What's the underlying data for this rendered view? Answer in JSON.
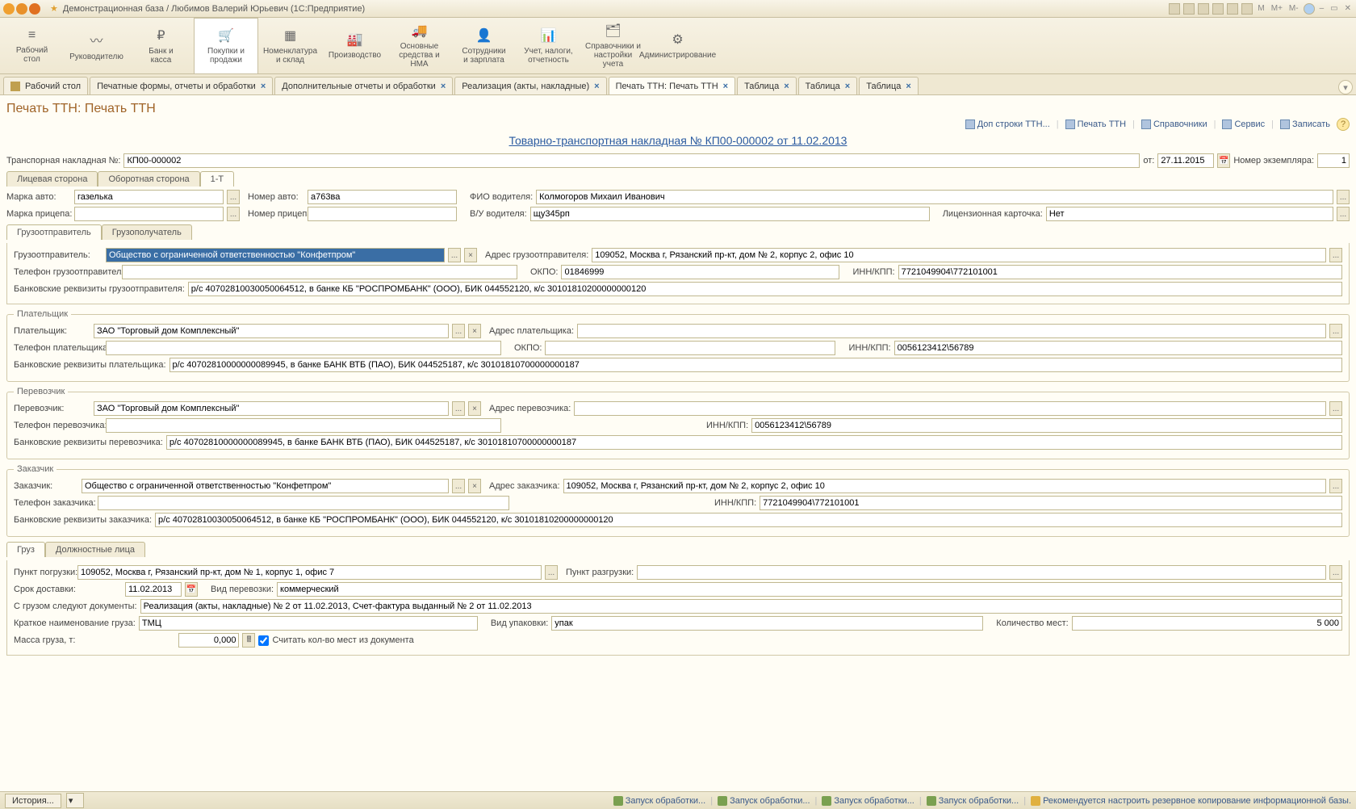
{
  "window": {
    "title": "Демонстрационная база / Любимов Валерий Юрьевич  (1С:Предприятие)",
    "right_icons": [
      "M",
      "M+",
      "M-"
    ]
  },
  "nav": [
    {
      "icon": "≡",
      "label": "Рабочий\nстол"
    },
    {
      "icon": "〰",
      "label": "Руководителю"
    },
    {
      "icon": "₽",
      "label": "Банк и\nкасса"
    },
    {
      "icon": "🛒",
      "label": "Покупки и\nпродажи"
    },
    {
      "icon": "▦",
      "label": "Номенклатура\nи склад"
    },
    {
      "icon": "🏭",
      "label": "Производство"
    },
    {
      "icon": "🚚",
      "label": "Основные\nсредства и НМА"
    },
    {
      "icon": "👤",
      "label": "Сотрудники\nи зарплата"
    },
    {
      "icon": "📊",
      "label": "Учет, налоги,\nотчетность"
    },
    {
      "icon": "🗂",
      "label": "Справочники и\nнастройки учета"
    },
    {
      "icon": "⚙",
      "label": "Администрирование"
    }
  ],
  "nav_active_index": 3,
  "tabs": [
    {
      "label": "Рабочий стол",
      "closable": false,
      "icon": true
    },
    {
      "label": "Печатные формы, отчеты и обработки",
      "closable": true
    },
    {
      "label": "Дополнительные отчеты и обработки",
      "closable": true
    },
    {
      "label": "Реализация (акты, накладные)",
      "closable": true
    },
    {
      "label": "Печать ТТН: Печать ТТН",
      "closable": true,
      "active": true
    },
    {
      "label": "Таблица",
      "closable": true
    },
    {
      "label": "Таблица",
      "closable": true
    },
    {
      "label": "Таблица",
      "closable": true
    }
  ],
  "page": {
    "title": "Печать ТТН: Печать ТТН",
    "toolbar": [
      {
        "label": "Доп строки ТТН..."
      },
      {
        "label": "Печать ТТН"
      },
      {
        "label": "Справочники"
      },
      {
        "label": "Сервис"
      },
      {
        "label": "Записать"
      }
    ],
    "doc_link": "Товарно-транспортная накладная № КП00-000002 от 11.02.2013"
  },
  "header": {
    "invoice_label": "Транспорная накладная №:",
    "invoice_no": "КП00-000002",
    "date_label": "от:",
    "date": "27.11.2015",
    "copies_label": "Номер экземпляра:",
    "copies": "1"
  },
  "sides_tabs": [
    "Лицевая сторона",
    "Оборотная сторона",
    "1-Т"
  ],
  "sides_active": 2,
  "vehicle": {
    "car_brand_label": "Марка авто:",
    "car_brand": "газелька",
    "car_no_label": "Номер авто:",
    "car_no": "а763ва",
    "driver_label": "ФИО водителя:",
    "driver": "Колмогоров Михаил Иванович",
    "trailer_brand_label": "Марка прицепа:",
    "trailer_brand": "",
    "trailer_no_label": "Номер прицепа:",
    "trailer_no": "",
    "license_doc_label": "В/У водителя:",
    "license_doc": "щу345рп",
    "lic_card_label": "Лицензионная карточка:",
    "lic_card": "Нет"
  },
  "shipper_tabs": [
    "Грузоотправитель",
    "Грузополучатель"
  ],
  "shipper_active": 0,
  "shipper": {
    "legend": "",
    "name_label": "Грузоотправитель:",
    "name": "Общество с ограниченной ответственностью \"Конфетпром\"",
    "addr_label": "Адрес грузоотправителя:",
    "addr": "109052, Москва г, Рязанский пр-кт, дом № 2, корпус 2, офис 10",
    "phone_label": "Телефон грузоотправителя:",
    "phone": "",
    "okpo_label": "ОКПО:",
    "okpo": "01846999",
    "inn_label": "ИНН/КПП:",
    "inn": "7721049904\\772101001",
    "bank_label": "Банковские реквизиты грузоотправителя:",
    "bank": "р/с 40702810030050064512, в банке КБ \"РОСПРОМБАНК\" (ООО), БИК 044552120, к/с 30101810200000000120"
  },
  "payer": {
    "legend": "Плательщик",
    "name_label": "Плательщик:",
    "name": "ЗАО \"Торговый дом Комплексный\"",
    "addr_label": "Адрес плательщика:",
    "addr": "",
    "phone_label": "Телефон плательщика:",
    "phone": "",
    "okpo_label": "ОКПО:",
    "okpo": "",
    "inn_label": "ИНН/КПП:",
    "inn": "0056123412\\56789",
    "bank_label": "Банковские реквизиты плательщика:",
    "bank": "р/с 40702810000000089945, в банке БАНК ВТБ (ПАО), БИК 044525187, к/с 30101810700000000187"
  },
  "carrier": {
    "legend": "Перевозчик",
    "name_label": "Перевозчик:",
    "name": "ЗАО \"Торговый дом Комплексный\"",
    "addr_label": "Адрес перевозчика:",
    "addr": "",
    "phone_label": "Телефон перевозчика:",
    "phone": "",
    "inn_label": "ИНН/КПП:",
    "inn": "0056123412\\56789",
    "bank_label": "Банковские реквизиты перевозчика:",
    "bank": "р/с 40702810000000089945, в банке БАНК ВТБ (ПАО), БИК 044525187, к/с 30101810700000000187"
  },
  "customer": {
    "legend": "Заказчик",
    "name_label": "Заказчик:",
    "name": "Общество с ограниченной ответственностью \"Конфетпром\"",
    "addr_label": "Адрес заказчика:",
    "addr": "109052, Москва г, Рязанский пр-кт, дом № 2, корпус 2, офис 10",
    "phone_label": "Телефон заказчика:",
    "phone": "",
    "inn_label": "ИНН/КПП:",
    "inn": "7721049904\\772101001",
    "bank_label": "Банковские реквизиты заказчика:",
    "bank": "р/с 40702810030050064512, в банке КБ \"РОСПРОМБАНК\" (ООО), БИК 044552120, к/с 30101810200000000120"
  },
  "cargo_tabs": [
    "Груз",
    "Должностные лица"
  ],
  "cargo_active": 0,
  "cargo": {
    "load_label": "Пункт погрузки:",
    "load": "109052, Москва г, Рязанский пр-кт, дом № 1, корпус 1, офис 7",
    "unload_label": "Пункт разгрузки:",
    "unload": "",
    "delivery_label": "Срок доставки:",
    "delivery": "11.02.2013",
    "transport_type_label": "Вид перевозки:",
    "transport_type": "коммерческий",
    "docs_label": "С грузом следуют документы:",
    "docs": "Реализация (акты, накладные) № 2 от 11.02.2013, Счет-фактура выданный № 2 от 11.02.2013",
    "short_name_label": "Краткое наименование груза:",
    "short_name": "ТМЦ",
    "package_label": "Вид упаковки:",
    "package": "упак",
    "places_label": "Количество мест:",
    "places": "5 000",
    "mass_label": "Масса груза, т:",
    "mass": "0,000",
    "checkbox_label": "Считать кол-во мест из документа"
  },
  "status": {
    "history_btn": "История...",
    "items": [
      "Запуск обработки...",
      "Запуск обработки...",
      "Запуск обработки...",
      "Запуск обработки..."
    ],
    "warning": "Рекомендуется настроить резервное копирование информационной базы."
  }
}
